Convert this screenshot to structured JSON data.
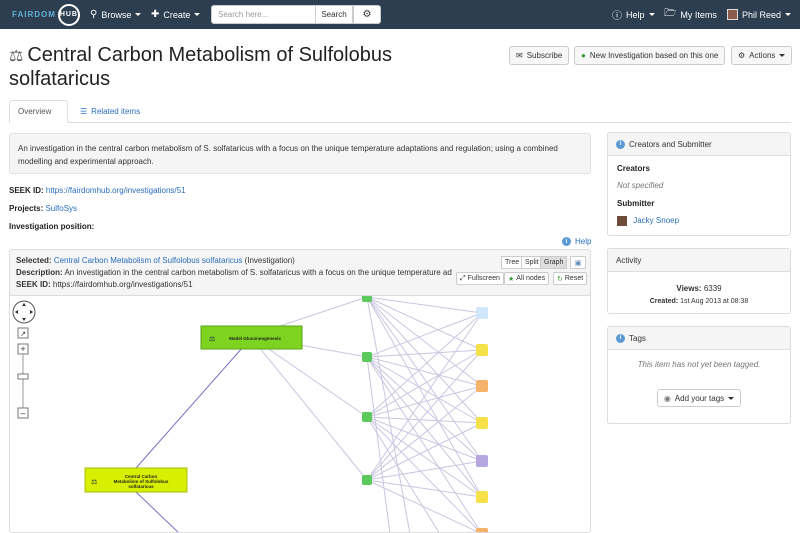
{
  "navbar": {
    "logo_text": "FAIRDOM",
    "logo_badge": "HUB",
    "browse": "Browse",
    "create": "Create",
    "search_placeholder": "Search here...",
    "search_button": "Search",
    "help": "Help",
    "my_items": "My Items",
    "user": "Phil Reed"
  },
  "header": {
    "title": "Central Carbon Metabolism of Sulfolobus solfataricus",
    "subscribe": "Subscribe",
    "new_investigation": "New Investigation based on this one",
    "actions": "Actions"
  },
  "tabs": [
    {
      "label": "Overview"
    },
    {
      "label": "Related items"
    }
  ],
  "description": "An investigation in the central carbon metabolism of S. solfataricus with a focus on the unique temperature adaptations and regulation; using a combined modelling and experimental approach.",
  "meta": {
    "seek_id_label": "SEEK ID:",
    "seek_id_value": "https://fairdomhub.org/investigations/51",
    "projects_label": "Projects:",
    "projects_value": "SulfoSys",
    "position_label": "Investigation position:"
  },
  "help_link": "Help",
  "graph": {
    "selected_label": "Selected:",
    "selected_value": "Central Carbon Metabolism of Sulfolobus solfataricus",
    "selected_suffix": "(Investigation)",
    "description_label": "Description:",
    "description_value": "An investigation in the central carbon metabolism of S. solfataricus with a focus on the unique temperature adaptations",
    "seek_id_label": "SEEK ID:",
    "seek_id_value": "https://fairdomhub.org/investigations/51",
    "view_tree": "Tree",
    "view_split": "Split",
    "view_graph": "Graph",
    "fullscreen": "Fullscreen",
    "all_nodes": "All nodes",
    "reset": "Reset",
    "node_model": "Model Gluconeogenesis",
    "node_investigation": "Central Carbon Metabolism of Sulfolobus solfataricus",
    "colors": {
      "model_node": "#7ed321",
      "investigation_node": "#d8f000",
      "study_node": "#5cc95c",
      "edge": "#c9c6e0"
    }
  },
  "sidebar": {
    "creators_title": "Creators and Submitter",
    "creators_label": "Creators",
    "creators_value": "Not specified",
    "submitter_label": "Submitter",
    "submitter_value": "Jacky Snoep",
    "activity_title": "Activity",
    "views_label": "Views:",
    "views_value": "6339",
    "created_label": "Created:",
    "created_value": "1st Aug 2013 at 08:38",
    "tags_title": "Tags",
    "tags_empty": "This item has not yet been tagged.",
    "add_tags": "Add your tags"
  }
}
